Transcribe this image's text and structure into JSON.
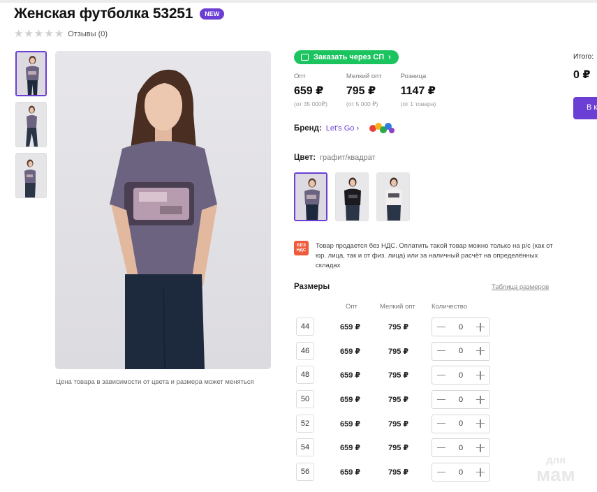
{
  "product": {
    "title": "Женская футболка 53251",
    "badge": "NEW",
    "reviews": "Отзывы (0)",
    "image_note": "Цена товара в зависимости от цвета и размера может меняться"
  },
  "order_sp": {
    "label": "Заказать через СП"
  },
  "prices": [
    {
      "label": "Опт",
      "value": "659 ₽",
      "sub": "(от 35 000₽)"
    },
    {
      "label": "Мелкий опт",
      "value": "795 ₽",
      "sub": "(от 5 000 ₽)"
    },
    {
      "label": "Розница",
      "value": "1147 ₽",
      "sub": "(от 1 товара)"
    }
  ],
  "brand": {
    "label": "Бренд:",
    "name": "Let's Go"
  },
  "color": {
    "label": "Цвет:",
    "value": "графит/квадрат"
  },
  "vat": {
    "icon_text": "БЕЗ НДС",
    "text": "Товар продается без НДС. Оплатить такой товар можно только на р/с (как от юр. лица, так и от физ. лица) или за наличный расчёт на определённых складах"
  },
  "sizes": {
    "title": "Размеры",
    "table_link": "Таблица размеров",
    "headers": {
      "opt": "Опт",
      "small_opt": "Мелкий опт",
      "qty": "Количество"
    },
    "rows": [
      {
        "size": "44",
        "opt": "659 ₽",
        "small_opt": "795 ₽",
        "qty": "0"
      },
      {
        "size": "46",
        "opt": "659 ₽",
        "small_opt": "795 ₽",
        "qty": "0"
      },
      {
        "size": "48",
        "opt": "659 ₽",
        "small_opt": "795 ₽",
        "qty": "0"
      },
      {
        "size": "50",
        "opt": "659 ₽",
        "small_opt": "795 ₽",
        "qty": "0"
      },
      {
        "size": "52",
        "opt": "659 ₽",
        "small_opt": "795 ₽",
        "qty": "0"
      },
      {
        "size": "54",
        "opt": "659 ₽",
        "small_opt": "795 ₽",
        "qty": "0"
      },
      {
        "size": "56",
        "opt": "659 ₽",
        "small_opt": "795 ₽",
        "qty": "0"
      }
    ]
  },
  "total": {
    "label": "Итого:",
    "value": "0 ₽",
    "cart_button": "В корзину"
  },
  "watermark": {
    "line1": "для",
    "line2": "мам"
  },
  "colors": {
    "accent": "#6b3fd4",
    "green": "#1cc460",
    "shirt_graphite": "#6c6380",
    "shirt_black": "#1b1b1f",
    "shirt_white": "#f1f0ef"
  }
}
